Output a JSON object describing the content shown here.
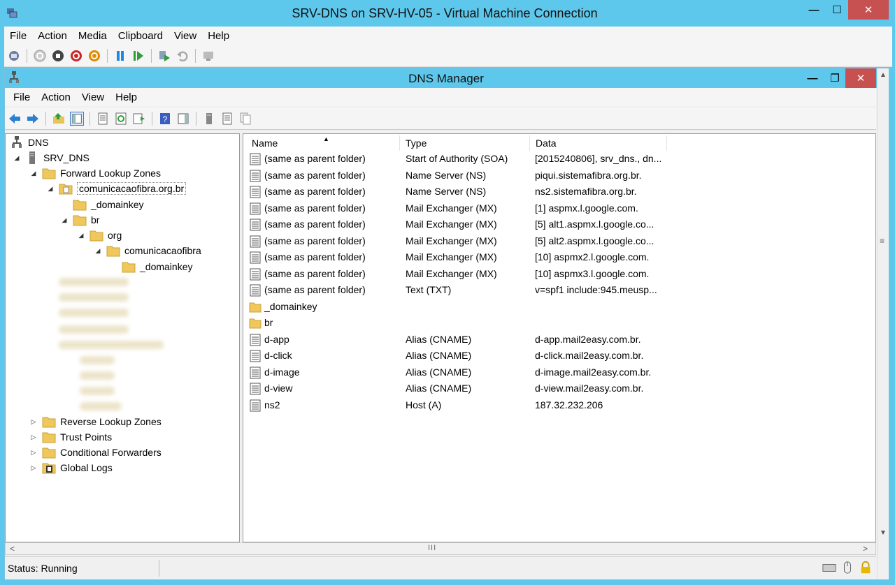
{
  "vm": {
    "title": "SRV-DNS on SRV-HV-05 - Virtual Machine Connection",
    "menu": [
      "File",
      "Action",
      "Media",
      "Clipboard",
      "View",
      "Help"
    ],
    "toolbar_icons": [
      "ctrl-alt-del-icon",
      "start-icon",
      "turn-off-icon",
      "shutdown-icon",
      "power-icon",
      "pause-icon",
      "resume-icon",
      "checkpoint-icon",
      "revert-icon",
      "enhanced-session-icon"
    ]
  },
  "dns": {
    "title": "DNS Manager",
    "menu": [
      "File",
      "Action",
      "View",
      "Help"
    ],
    "toolbar_icons": [
      "back-icon",
      "forward-icon",
      "up-folder-icon",
      "show-hide-tree-icon",
      "properties-icon",
      "refresh-icon",
      "export-icon",
      "help-icon",
      "show-hide-action-icon",
      "server-icon",
      "list-icon",
      "copy-icon"
    ]
  },
  "tree": {
    "root": "DNS",
    "server": "SRV_DNS",
    "forward": "Forward Lookup Zones",
    "zone": "comunicacaofibra.org.br",
    "domainkey1": "_domainkey",
    "br": "br",
    "org": "org",
    "comunicacaofibra": "comunicacaofibra",
    "domainkey2": "_domainkey",
    "reverse": "Reverse Lookup Zones",
    "trust": "Trust Points",
    "conditional": "Conditional Forwarders",
    "logs": "Global Logs"
  },
  "list": {
    "columns": [
      "Name",
      "Type",
      "Data"
    ],
    "rows": [
      {
        "name": "(same as parent folder)",
        "type": "Start of Authority (SOA)",
        "data": "[2015240806], srv_dns., dn...",
        "kind": "record"
      },
      {
        "name": "(same as parent folder)",
        "type": "Name Server (NS)",
        "data": "piqui.sistemafibra.org.br.",
        "kind": "record"
      },
      {
        "name": "(same as parent folder)",
        "type": "Name Server (NS)",
        "data": "ns2.sistemafibra.org.br.",
        "kind": "record"
      },
      {
        "name": "(same as parent folder)",
        "type": "Mail Exchanger (MX)",
        "data": "[1]  aspmx.l.google.com.",
        "kind": "record"
      },
      {
        "name": "(same as parent folder)",
        "type": "Mail Exchanger (MX)",
        "data": "[5]  alt1.aspmx.l.google.co...",
        "kind": "record"
      },
      {
        "name": "(same as parent folder)",
        "type": "Mail Exchanger (MX)",
        "data": "[5]  alt2.aspmx.l.google.co...",
        "kind": "record"
      },
      {
        "name": "(same as parent folder)",
        "type": "Mail Exchanger (MX)",
        "data": "[10]  aspmx2.l.google.com.",
        "kind": "record"
      },
      {
        "name": "(same as parent folder)",
        "type": "Mail Exchanger (MX)",
        "data": "[10]  aspmx3.l.google.com.",
        "kind": "record"
      },
      {
        "name": "(same as parent folder)",
        "type": "Text (TXT)",
        "data": "v=spf1 include:945.meusp...",
        "kind": "record"
      },
      {
        "name": "_domainkey",
        "type": "",
        "data": "",
        "kind": "folder"
      },
      {
        "name": "br",
        "type": "",
        "data": "",
        "kind": "folder"
      },
      {
        "name": "d-app",
        "type": "Alias (CNAME)",
        "data": "d-app.mail2easy.com.br.",
        "kind": "record"
      },
      {
        "name": "d-click",
        "type": "Alias (CNAME)",
        "data": "d-click.mail2easy.com.br.",
        "kind": "record"
      },
      {
        "name": "d-image",
        "type": "Alias (CNAME)",
        "data": "d-image.mail2easy.com.br.",
        "kind": "record"
      },
      {
        "name": "d-view",
        "type": "Alias (CNAME)",
        "data": "d-view.mail2easy.com.br.",
        "kind": "record"
      },
      {
        "name": "ns2",
        "type": "Host (A)",
        "data": "187.32.232.206",
        "kind": "record"
      }
    ]
  },
  "status": {
    "text": "Status: Running"
  },
  "colors": {
    "titlebar": "#5ec8ec",
    "close": "#c75050",
    "folder": "#f0c75a"
  }
}
